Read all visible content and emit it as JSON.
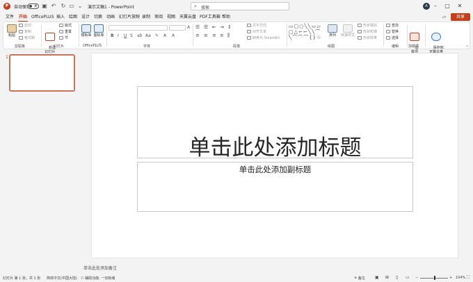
{
  "titlebar": {
    "autosave_label": "自动保存",
    "autosave_state": "关",
    "doc_title": "演示文稿1 - PowerPoint",
    "search_placeholder": "搜索",
    "avatar_initial": "A"
  },
  "tabs": [
    "文件",
    "开始",
    "OfficePLUS",
    "插入",
    "绘图",
    "设计",
    "切换",
    "动画",
    "幻灯片放映",
    "录制",
    "审阅",
    "视图",
    "天翼云盘",
    "PDF工具箱",
    "帮助"
  ],
  "active_tab": "开始",
  "share_label": "共享",
  "ribbon": {
    "clipboard": {
      "paste": "粘贴",
      "cut": "剪切",
      "copy": "复制",
      "format_painter": "格式刷",
      "label": "剪贴板"
    },
    "slides": {
      "new_slide": "新建\n幻灯片",
      "layout": "版式",
      "reset": "重置",
      "section": "节",
      "label": "幻灯片"
    },
    "officeplus": {
      "template": "模板库",
      "icons": "图标库",
      "label": "OfficePLUS"
    },
    "font": {
      "label": "字体"
    },
    "paragraph": {
      "text_direction": "文字方向",
      "align_text": "对齐文本",
      "smartart": "转换为 SmartArt",
      "label": "段落"
    },
    "drawing": {
      "arrange": "排列",
      "quick_styles": "快速样式",
      "shape_fill": "形状填充",
      "shape_outline": "形状轮廓",
      "shape_effects": "形状效果",
      "label": "绘图"
    },
    "editing": {
      "find": "查找",
      "replace": "替换",
      "select": "选择",
      "label": "编辑"
    },
    "addins": {
      "addin": "加\n载项",
      "label": "加载项"
    },
    "cloud": {
      "save": "保存到\n天翼云盘"
    }
  },
  "thumbnail": {
    "number": "1"
  },
  "slide": {
    "title_placeholder": "单击此处添加标题",
    "subtitle_placeholder": "单击此处添加副标题"
  },
  "notes_placeholder": "单击此处添加备注",
  "status": {
    "slide_info": "幻灯片 第 1 张，共 1 张",
    "language": "简体中文(中国大陆)",
    "accessibility": "辅助功能: 一切就绪",
    "notes_btn": "备注",
    "zoom": "104%"
  },
  "colors": {
    "accent": "#c43e1c"
  }
}
